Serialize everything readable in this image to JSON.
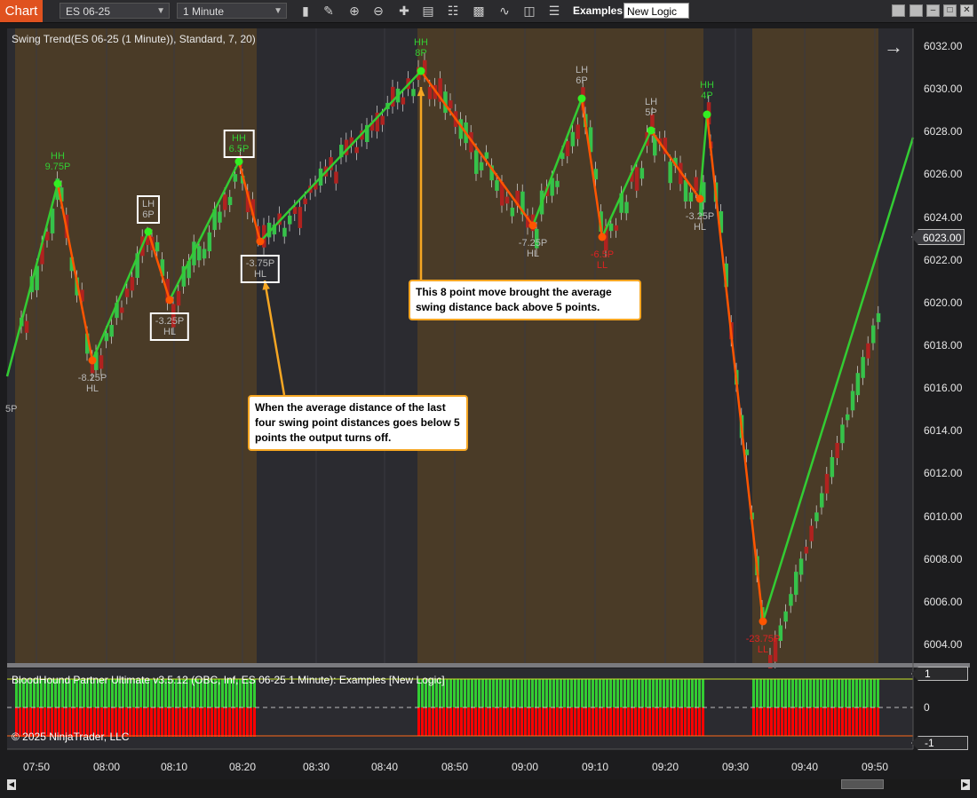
{
  "toolbar": {
    "tab": "Chart",
    "instrument": "ES 06-25",
    "interval": "1 Minute",
    "examples_label": "Examples",
    "new_logic_value": "New Logic",
    "icons": [
      "bar-type-icon",
      "draw-pencil-icon",
      "zoom-in-icon",
      "zoom-out-icon",
      "crosshair-icon",
      "data-box-icon",
      "properties-icon",
      "strategies-icon",
      "indicators-icon",
      "templates-icon",
      "list-icon"
    ]
  },
  "chart": {
    "title": "Swing Trend(ES 06-25 (1 Minute)), Standard, 7, 20)",
    "current_price": "6023.00",
    "price_axis": [
      "6032.00",
      "6030.00",
      "6028.00",
      "6026.00",
      "6024.00",
      "6022.00",
      "6020.00",
      "6018.00",
      "6016.00",
      "6014.00",
      "6012.00",
      "6010.00",
      "6008.00",
      "6006.00",
      "6004.00"
    ],
    "time_axis": [
      "07:50",
      "08:00",
      "08:10",
      "08:20",
      "08:30",
      "08:40",
      "08:50",
      "09:00",
      "09:10",
      "09:20",
      "09:30",
      "09:40",
      "09:50"
    ],
    "edge_label": "5P",
    "colors": {
      "up": "#36c24a",
      "down": "#b0221f",
      "zig_up": "#33cc33",
      "zig_down": "#ff5500",
      "band": "#4a3b27",
      "bg": "#2b2b30"
    }
  },
  "swings": [
    {
      "l1": "HH",
      "l2": "9.75P",
      "color": "#33cc33",
      "boxed": false
    },
    {
      "l1": "-8.25P",
      "l2": "HL",
      "color": "#b8b8b8",
      "boxed": false
    },
    {
      "l1": "LH",
      "l2": "6P",
      "color": "#b8b8b8",
      "boxed": true
    },
    {
      "l1": "-3.25P",
      "l2": "HL",
      "color": "#b8b8b8",
      "boxed": true
    },
    {
      "l1": "HH",
      "l2": "6.5P",
      "color": "#33cc33",
      "boxed": true
    },
    {
      "l1": "-3.75P",
      "l2": "HL",
      "color": "#b8b8b8",
      "boxed": true
    },
    {
      "l1": "HH",
      "l2": "8P",
      "color": "#33cc33",
      "boxed": false
    },
    {
      "l1": "-7.25P",
      "l2": "HL",
      "color": "#b8b8b8",
      "boxed": false
    },
    {
      "l1": "LH",
      "l2": "6P",
      "color": "#b8b8b8",
      "boxed": false
    },
    {
      "l1": "-6.5P",
      "l2": "LL",
      "color": "#dd2222",
      "boxed": false
    },
    {
      "l1": "LH",
      "l2": "5P",
      "color": "#b8b8b8",
      "boxed": false
    },
    {
      "l1": "HH",
      "l2": "4P",
      "color": "#33cc33",
      "boxed": false
    },
    {
      "l1": "-3.25P",
      "l2": "HL",
      "color": "#b8b8b8",
      "boxed": false
    },
    {
      "l1": "-23.75P",
      "l2": "LL",
      "color": "#dd2222",
      "boxed": false
    }
  ],
  "callouts": {
    "top": "This 8 point move brought the average swing distance back above 5 points.",
    "bottom": "When the average distance of the last four swing point distances goes below 5 points the output turns off."
  },
  "indicator": {
    "title": "BloodHound Partner Ultimate v3.5.12 (OBC, Inf, ES 06-25 1 Minute): Examples  [New Logic]",
    "axis_labels": [
      "1",
      "0",
      "-1"
    ],
    "copyright": "© 2025 NinjaTrader, LLC"
  }
}
